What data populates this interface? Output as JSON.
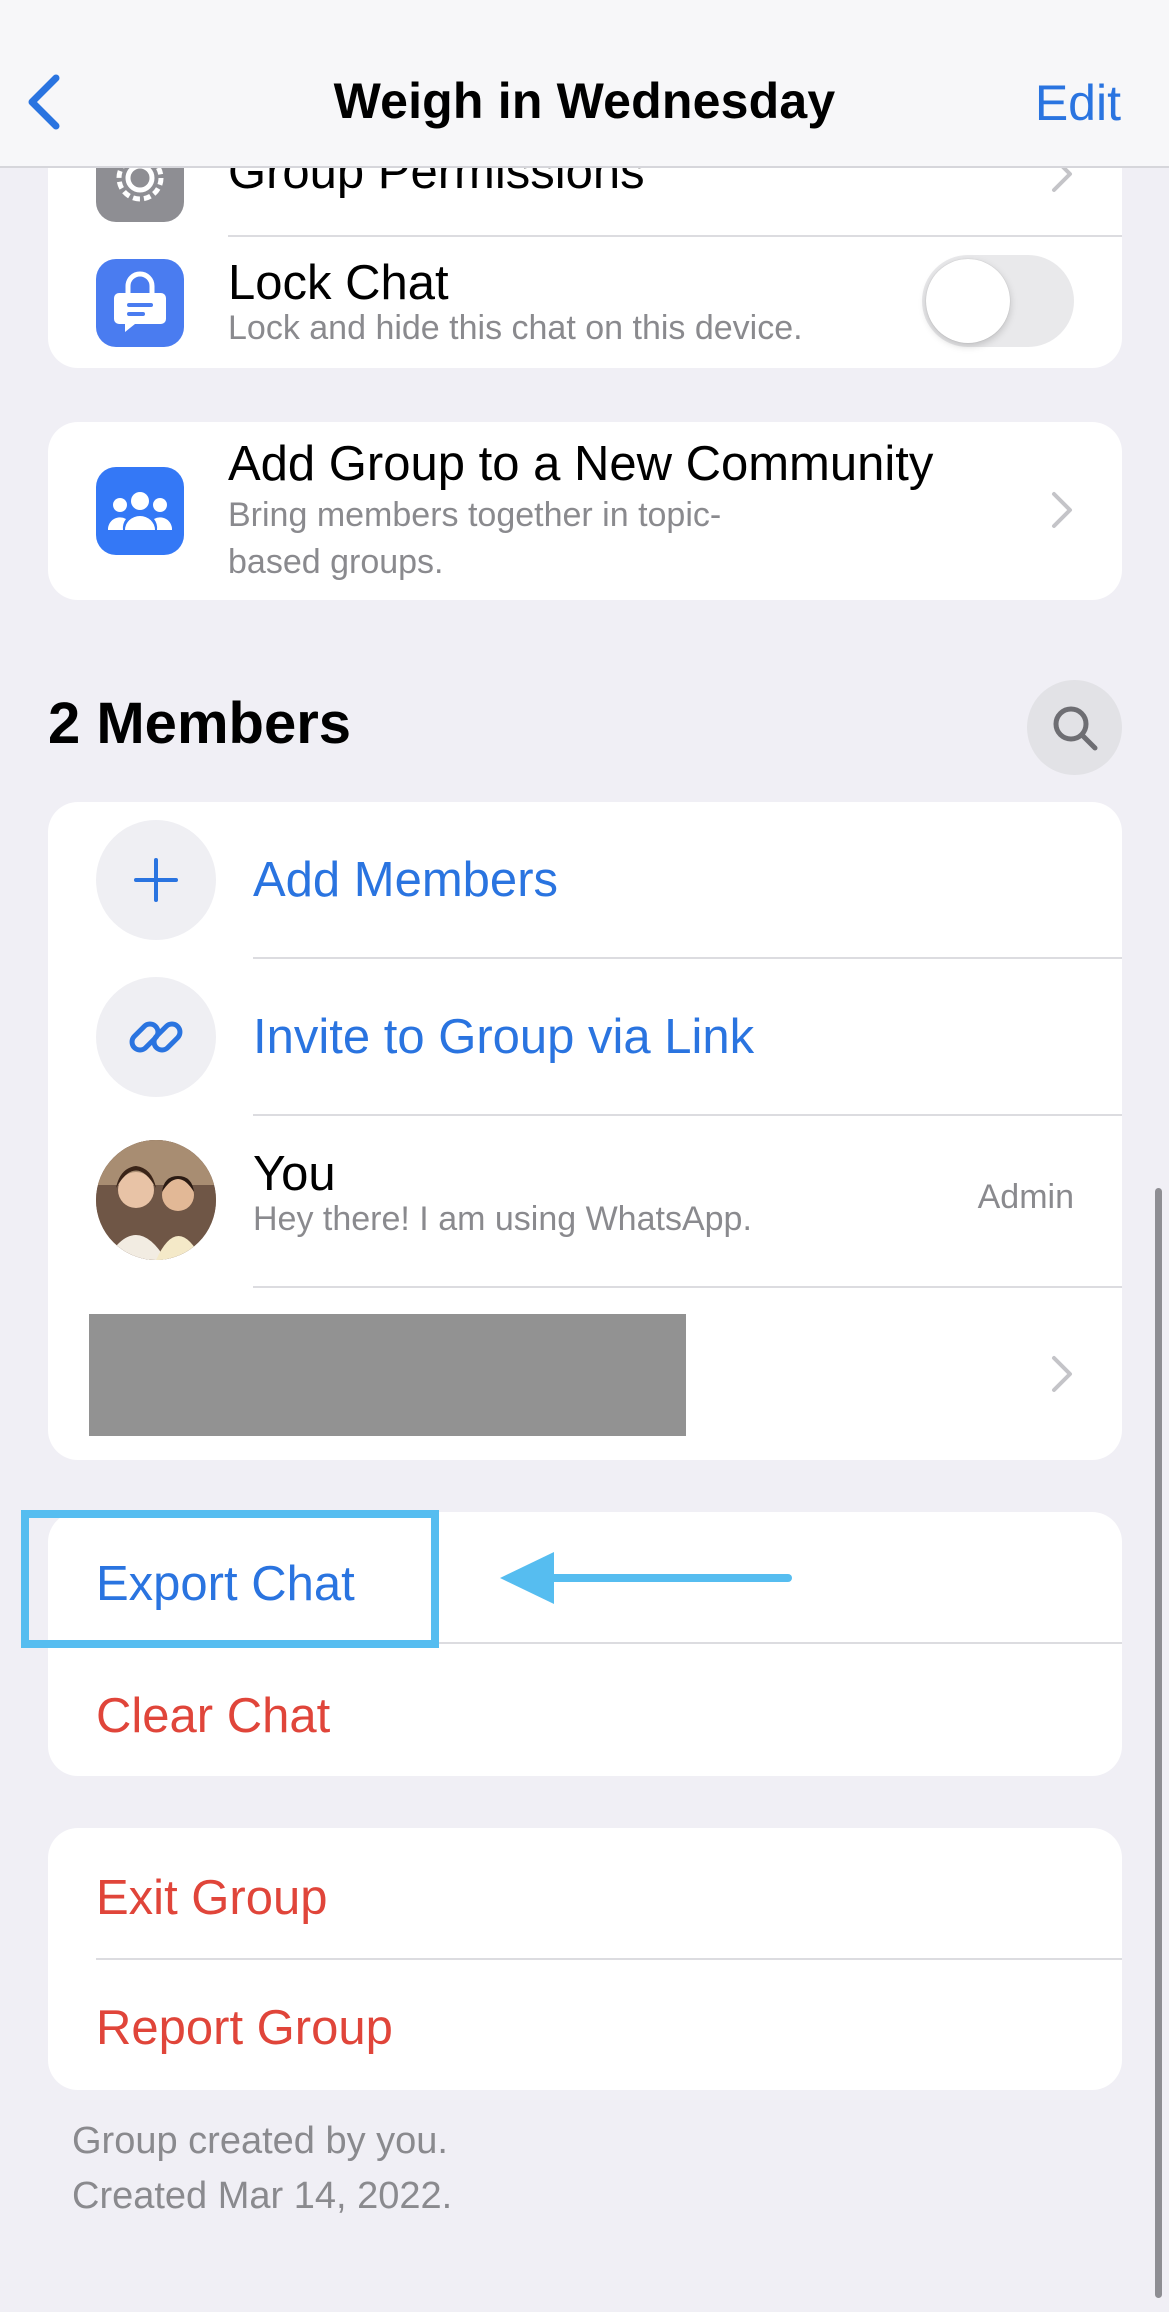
{
  "nav": {
    "back_icon": "chevron-left-icon",
    "title": "Weigh in Wednesday",
    "edit_label": "Edit"
  },
  "settings_card": {
    "group_permissions": {
      "label": "Group Permissions",
      "icon": "gear-icon"
    },
    "lock_chat": {
      "label": "Lock Chat",
      "description": "Lock and hide this chat on this device.",
      "icon": "lock-chat-icon",
      "enabled": false
    }
  },
  "community_card": {
    "label": "Add Group to a New Community",
    "description_line1": "Bring members together in topic-",
    "description_line2": "based groups.",
    "icon": "community-icon"
  },
  "members": {
    "heading": "2 Members",
    "search_icon": "search-icon",
    "add_members_label": "Add Members",
    "invite_link_label": "Invite to Group via Link",
    "list": [
      {
        "name": "You",
        "status": "Hey there! I am using WhatsApp.",
        "role": "Admin"
      }
    ]
  },
  "chat_actions": {
    "export_label": "Export Chat",
    "clear_label": "Clear Chat"
  },
  "group_actions": {
    "exit_label": "Exit Group",
    "report_label": "Report Group"
  },
  "footer": {
    "line1": "Group created by you.",
    "line2": "Created Mar 14, 2022."
  },
  "colors": {
    "accent_blue": "#2a74e0",
    "destructive_red": "#e0453a",
    "annotation_blue": "#56bdf0",
    "background": "#f0eff5"
  }
}
